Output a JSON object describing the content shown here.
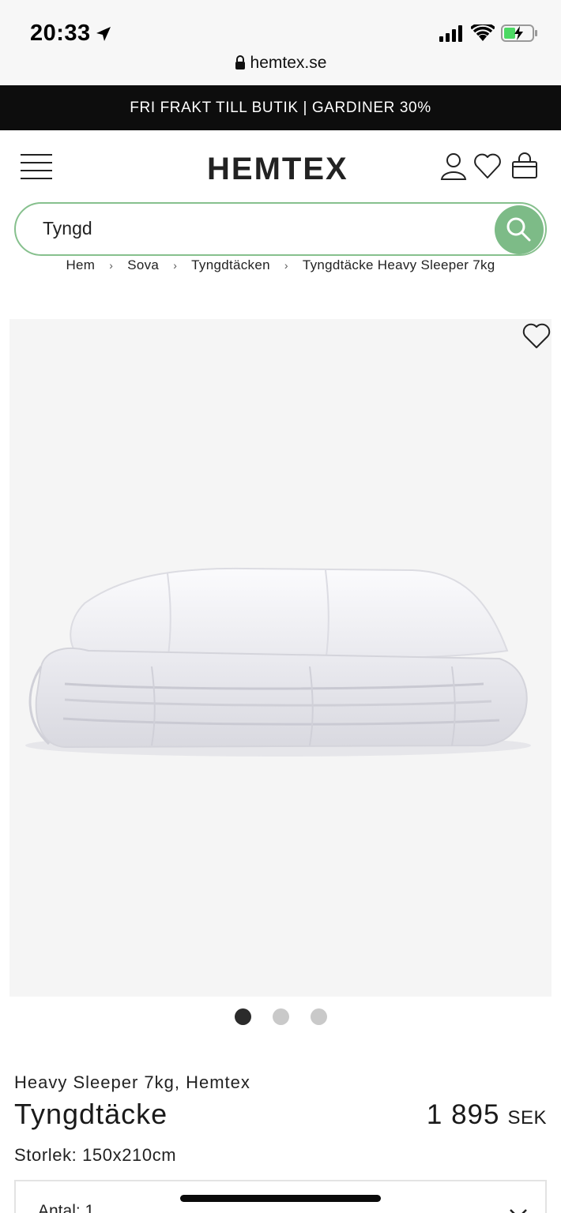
{
  "status_bar": {
    "time": "20:33",
    "icons": [
      "location-arrow-icon",
      "cellular-signal-icon",
      "wifi-icon",
      "battery-charging-icon"
    ]
  },
  "browser": {
    "url": "hemtex.se"
  },
  "promo_banner": {
    "text": "FRI FRAKT TILL BUTIK | GARDINER 30%"
  },
  "header": {
    "logo_text": "HEMTEX",
    "icons": [
      "menu-icon",
      "account-icon",
      "wishlist-heart-icon",
      "cart-basket-icon"
    ]
  },
  "search": {
    "value": "Tyngd"
  },
  "breadcrumb": {
    "items": [
      "Hem",
      "Sova",
      "Tyngdtäcken",
      "Tyngdtäcke Heavy Sleeper 7kg"
    ],
    "separator": "›"
  },
  "gallery": {
    "slide_count": 3,
    "active_index": 0
  },
  "product": {
    "brand_line": "Heavy Sleeper 7kg, Hemtex",
    "name": "Tyngdtäcke",
    "price_amount": "1 895",
    "price_currency": "SEK",
    "size_text": "Storlek: 150x210cm",
    "quantity_text": "Antal: 1"
  },
  "colors": {
    "accent_green": "#7dbb87",
    "search_border": "#86c08d",
    "banner_bg": "#0d0d0d",
    "image_bg": "#f5f5f5"
  }
}
